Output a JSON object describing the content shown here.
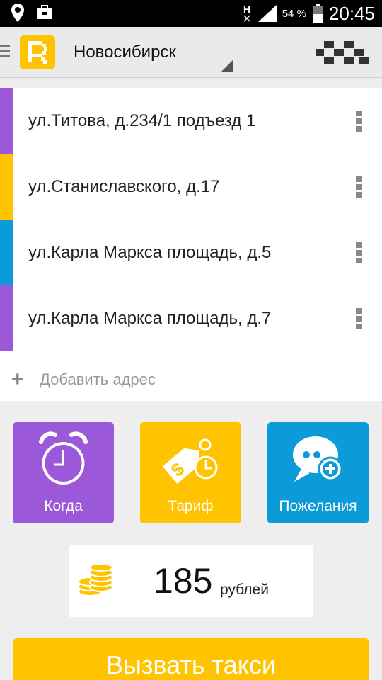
{
  "status_bar": {
    "battery_percent": "54 %",
    "time": "20:45",
    "network_label": "H"
  },
  "header": {
    "logo_letter": "R",
    "city": "Новосибирск"
  },
  "addresses": [
    {
      "text": "ул.Титова, д.234/1 подъезд 1",
      "color": "#9b59d9"
    },
    {
      "text": "ул.Станиславского, д.17",
      "color": "#ffc300"
    },
    {
      "text": "ул.Карла Маркса площадь, д.5",
      "color": "#0a9bd8"
    },
    {
      "text": "ул.Карла Маркса площадь, д.7",
      "color": "#9b59d9"
    }
  ],
  "add_address": {
    "icon": "+",
    "label": "Добавить адрес"
  },
  "options": {
    "when": {
      "label": "Когда",
      "color": "#9b59d9",
      "icon": "alarm-clock-icon"
    },
    "tariff": {
      "label": "Тариф",
      "color": "#ffc300",
      "icon": "price-tag-icon"
    },
    "wishes": {
      "label": "Пожелания",
      "color": "#0a9bd8",
      "icon": "chat-bubble-plus-icon"
    }
  },
  "price": {
    "value": "185",
    "unit": "рублей",
    "icon": "coins-icon"
  },
  "call_button": {
    "label": "Вызвать такси",
    "color": "#ffc300"
  }
}
